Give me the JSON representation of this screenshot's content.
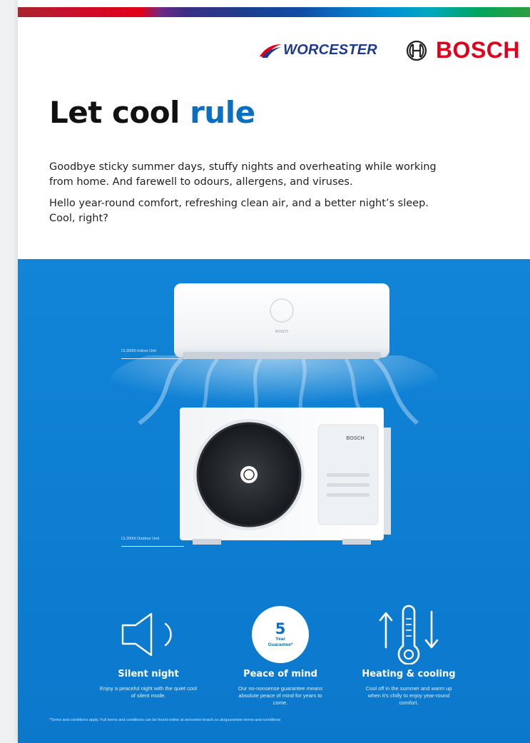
{
  "colors": {
    "brand_red": "#e2001a",
    "worcester_blue": "#1d3a8f",
    "accent_blue": "#0a6fc0",
    "panel_blue": "#0e7fd3"
  },
  "header": {
    "worcester_logo": "WORCESTER",
    "bosch_logo": "BOSCH"
  },
  "headline": {
    "part1": "Let cool",
    "accent": "rule"
  },
  "intro": {
    "paragraph1": "Goodbye sticky summer days, stuffy nights and overheating while working from home. And farewell to odours, allergens, and viruses.",
    "paragraph2": "Hello year-round comfort, refreshing clean air, and a better night’s sleep. Cool, right?"
  },
  "units": {
    "indoor_label": "CL3000i Indoor Unit",
    "outdoor_label": "CL3000i Outdoor Unit",
    "indoor_brand": "BOSCH",
    "outdoor_brand": "BOSCH"
  },
  "features": [
    {
      "icon": "speaker-icon",
      "title": "Silent night",
      "desc": "Enjoy a peaceful night with the quiet cool of silent mode."
    },
    {
      "icon": "guarantee-badge",
      "badge_number": "5",
      "badge_line1": "Year",
      "badge_line2": "Guarantee*",
      "title": "Peace of mind",
      "desc": "Our no-nonsense guarantee means absolute peace of mind for years to come."
    },
    {
      "icon": "thermometer-icon",
      "title": "Heating & cooling",
      "desc": "Cool off in the summer and warm up when it’s chilly to enjoy year-round comfort."
    }
  ],
  "terms": "*Terms and conditions apply. Full terms and conditions can be found online at worcester-bosch.co.uk/guarantee-terms-and-conditions"
}
